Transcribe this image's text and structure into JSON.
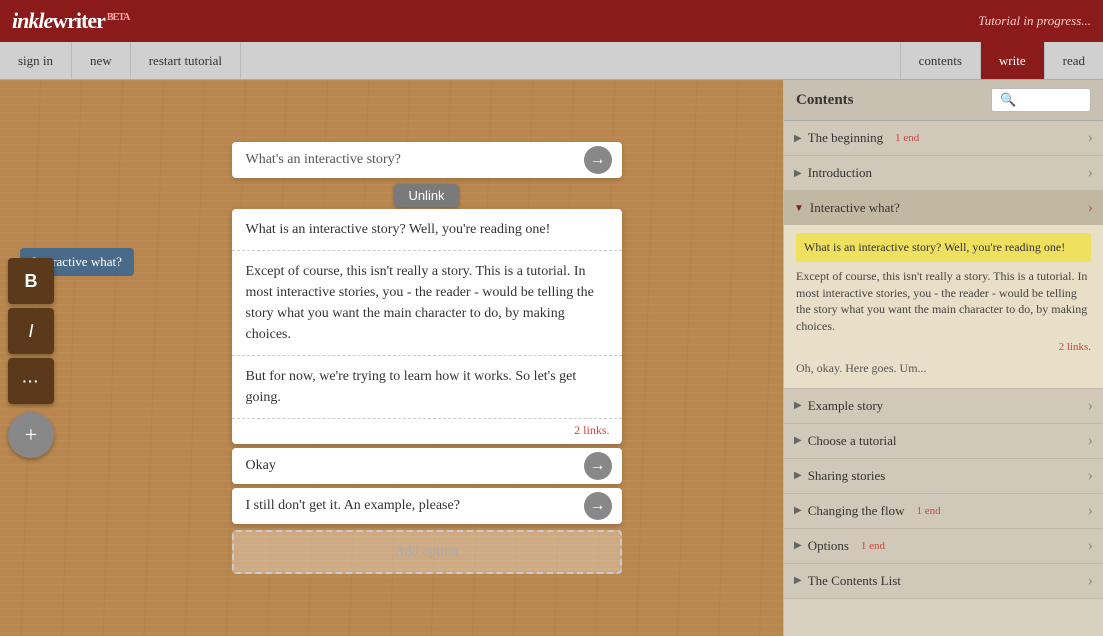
{
  "topBar": {
    "logo": "inklewriter",
    "beta": "BETA",
    "tutorialStatus": "Tutorial in progress..."
  },
  "nav": {
    "signIn": "sign in",
    "new": "new",
    "restartTutorial": "restart tutorial",
    "contents": "contents",
    "write": "write",
    "read": "read"
  },
  "storyEditor": {
    "topCard": "What's an interactive story?",
    "unlinkBtn": "Unlink",
    "interactiveLabel": "Interactive what?",
    "mainCard": {
      "line1": "What is an interactive story? Well, you're reading one!",
      "separator1": "",
      "line2": "Except of course, this isn't really a story. This is a tutorial. In most interactive stories, you - the reader - would be telling the story what you want the main character to do, by making choices.",
      "separator2": "",
      "line3": "But for now, we're trying to learn how it works. So let's get going.",
      "linksCount": "2 links."
    },
    "options": [
      {
        "text": "Okay"
      },
      {
        "text": "I still don't get it. An example, please?"
      }
    ],
    "addOption": "Add option"
  },
  "contents": {
    "title": "Contents",
    "searchPlaceholder": "🔍",
    "items": [
      {
        "id": "the-beginning",
        "label": "The beginning",
        "endBadge": "1 end",
        "expanded": false
      },
      {
        "id": "introduction",
        "label": "Introduction",
        "endBadge": "",
        "expanded": false
      },
      {
        "id": "interactive-what",
        "label": "Interactive what?",
        "endBadge": "",
        "expanded": true,
        "expandedContent": {
          "highlight": "What is an interactive story? Well, you're reading one!",
          "text1": "Except of course, this isn't really a story. This is a tutorial. In most interactive stories, you - the reader - would be telling the story what you want the main character to do, by making choices.",
          "linksCount": "2 links.",
          "secondaryText": "Oh, okay. Here goes. Um..."
        }
      },
      {
        "id": "example-story",
        "label": "Example story",
        "endBadge": "",
        "expanded": false
      },
      {
        "id": "choose-tutorial",
        "label": "Choose a tutorial",
        "endBadge": "",
        "expanded": false
      },
      {
        "id": "sharing-stories",
        "label": "Sharing stories",
        "endBadge": "",
        "expanded": false
      },
      {
        "id": "changing-flow",
        "label": "Changing the flow",
        "endBadge": "1 end",
        "expanded": false
      },
      {
        "id": "options",
        "label": "Options",
        "endBadge": "1 end",
        "expanded": false
      },
      {
        "id": "contents-list-item",
        "label": "The Contents List",
        "endBadge": "",
        "expanded": false
      }
    ]
  },
  "icons": {
    "arrow": "→",
    "triangleRight": "▶",
    "triangleDown": "▼",
    "navArrow": "›",
    "bold": "B",
    "italic": "I",
    "dots": "···",
    "plus": "+"
  }
}
